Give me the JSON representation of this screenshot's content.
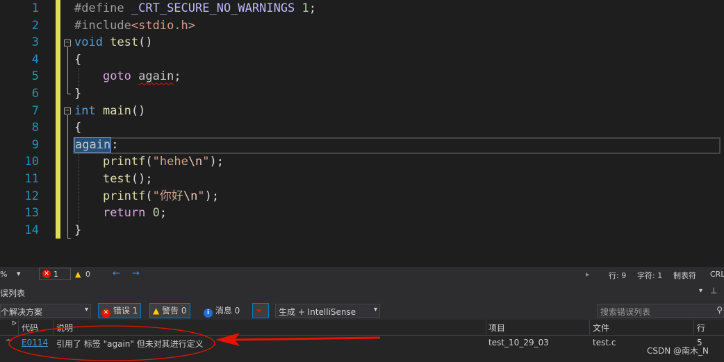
{
  "editor": {
    "line_numbers": [
      "1",
      "2",
      "3",
      "4",
      "5",
      "6",
      "7",
      "8",
      "9",
      "10",
      "11",
      "12",
      "13",
      "14"
    ],
    "lines": {
      "l1_kw": "#define ",
      "l1_macro": "_CRT_SECURE_NO_WARNINGS",
      "l1_num": "1",
      "l1_semi": ";",
      "l2_kw": "#include",
      "l2_file": "<stdio.h>",
      "l3_type": "void",
      "l3_fn": "test",
      "l3_rest": "()",
      "l4": "{",
      "l5_kw": "goto",
      "l5_label": "again",
      "l5_semi": ";",
      "l6": "}",
      "l7_type": "int",
      "l7_fn": "main",
      "l7_rest": "()",
      "l8": "{",
      "l9_label": "again",
      "l9_colon": ":",
      "l10_fn": "printf",
      "l10_open": "(",
      "l10_str": "\"hehe",
      "l10_esc": "\\n",
      "l10_strend": "\"",
      "l10_close": ");",
      "l11_fn": "test",
      "l11_rest": "();",
      "l12_fn": "printf",
      "l12_open": "(",
      "l12_str": "\"你好",
      "l12_esc": "\\n",
      "l12_strend": "\"",
      "l12_close": ");",
      "l13_kw": "return",
      "l13_num": "0",
      "l13_semi": ";",
      "l14": "}"
    }
  },
  "status": {
    "zoom": "%",
    "errors": "1",
    "warnings": "0",
    "row": "行: 9",
    "col": "字符: 1",
    "tabs": "制表符",
    "eol": "CRL"
  },
  "error_list": {
    "title": "误列表",
    "scope": "个解决方案",
    "errors_btn": "错误 1",
    "warnings_btn": "警告 0",
    "messages_btn": "消息 0",
    "source": "生成 + IntelliSense",
    "search_placeholder": "搜索错误列表",
    "columns": {
      "code": "代码",
      "description": "说明",
      "project": "项目",
      "file": "文件",
      "line": "行"
    },
    "rows": [
      {
        "code": "E0114",
        "description": "引用了 标签 \"again\" 但未对其进行定义",
        "project": "test_10_29_03",
        "file": "test.c",
        "line": "5"
      }
    ]
  },
  "watermark": "CSDN @南木_N",
  "colors": {
    "background": "#1e1e1e",
    "line_number": "#2b91af",
    "keyword": "#569cd6",
    "control": "#d8a0df",
    "function": "#dcdcaa",
    "string": "#d69d85",
    "macro": "#beb7ff",
    "change_marker": "#dede5a",
    "annotation": "#e51400"
  }
}
